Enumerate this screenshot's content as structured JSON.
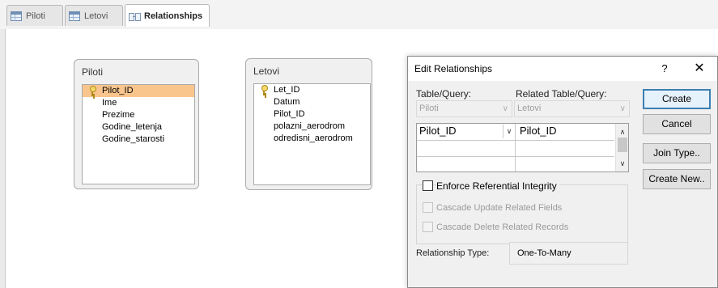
{
  "tabs": [
    {
      "label": "Piloti",
      "icon": "table-icon",
      "active": false
    },
    {
      "label": "Letovi",
      "icon": "table-icon",
      "active": false
    },
    {
      "label": "Relationships",
      "icon": "relationships-icon",
      "active": true
    }
  ],
  "tables": {
    "piloti": {
      "title": "Piloti",
      "fields": [
        "Pilot_ID",
        "Ime",
        "Prezime",
        "Godine_letenja",
        "Godine_starosti"
      ],
      "key_field": "Pilot_ID",
      "selected_field": "Pilot_ID"
    },
    "letovi": {
      "title": "Letovi",
      "fields": [
        "Let_ID",
        "Datum",
        "Pilot_ID",
        "polazni_aerodrom",
        "odredisni_aerodrom"
      ],
      "key_field": "Let_ID"
    }
  },
  "dialog": {
    "title": "Edit Relationships",
    "help": "?",
    "close": "✕",
    "table_query_label": "Table/Query:",
    "related_table_query_label": "Related Table/Query:",
    "table_query_value": "Piloti",
    "related_table_query_value": "Letovi",
    "field_grid": [
      {
        "field": "Pilot_ID",
        "related_field": "Pilot_ID"
      },
      {
        "field": "",
        "related_field": ""
      },
      {
        "field": "",
        "related_field": ""
      }
    ],
    "enforce_ri_label": "Enforce Referential Integrity",
    "enforce_ri_checked": false,
    "cascade_update_label": "Cascade Update Related Fields",
    "cascade_delete_label": "Cascade Delete Related Records",
    "relationship_type_label": "Relationship Type:",
    "relationship_type_value": "One-To-Many",
    "buttons": {
      "create": "Create",
      "cancel": "Cancel",
      "join_type": "Join Type..",
      "create_new": "Create New.."
    }
  },
  "colors": {
    "selected_field": "#f9c58d",
    "default_button_border": "#3c7fb1"
  }
}
